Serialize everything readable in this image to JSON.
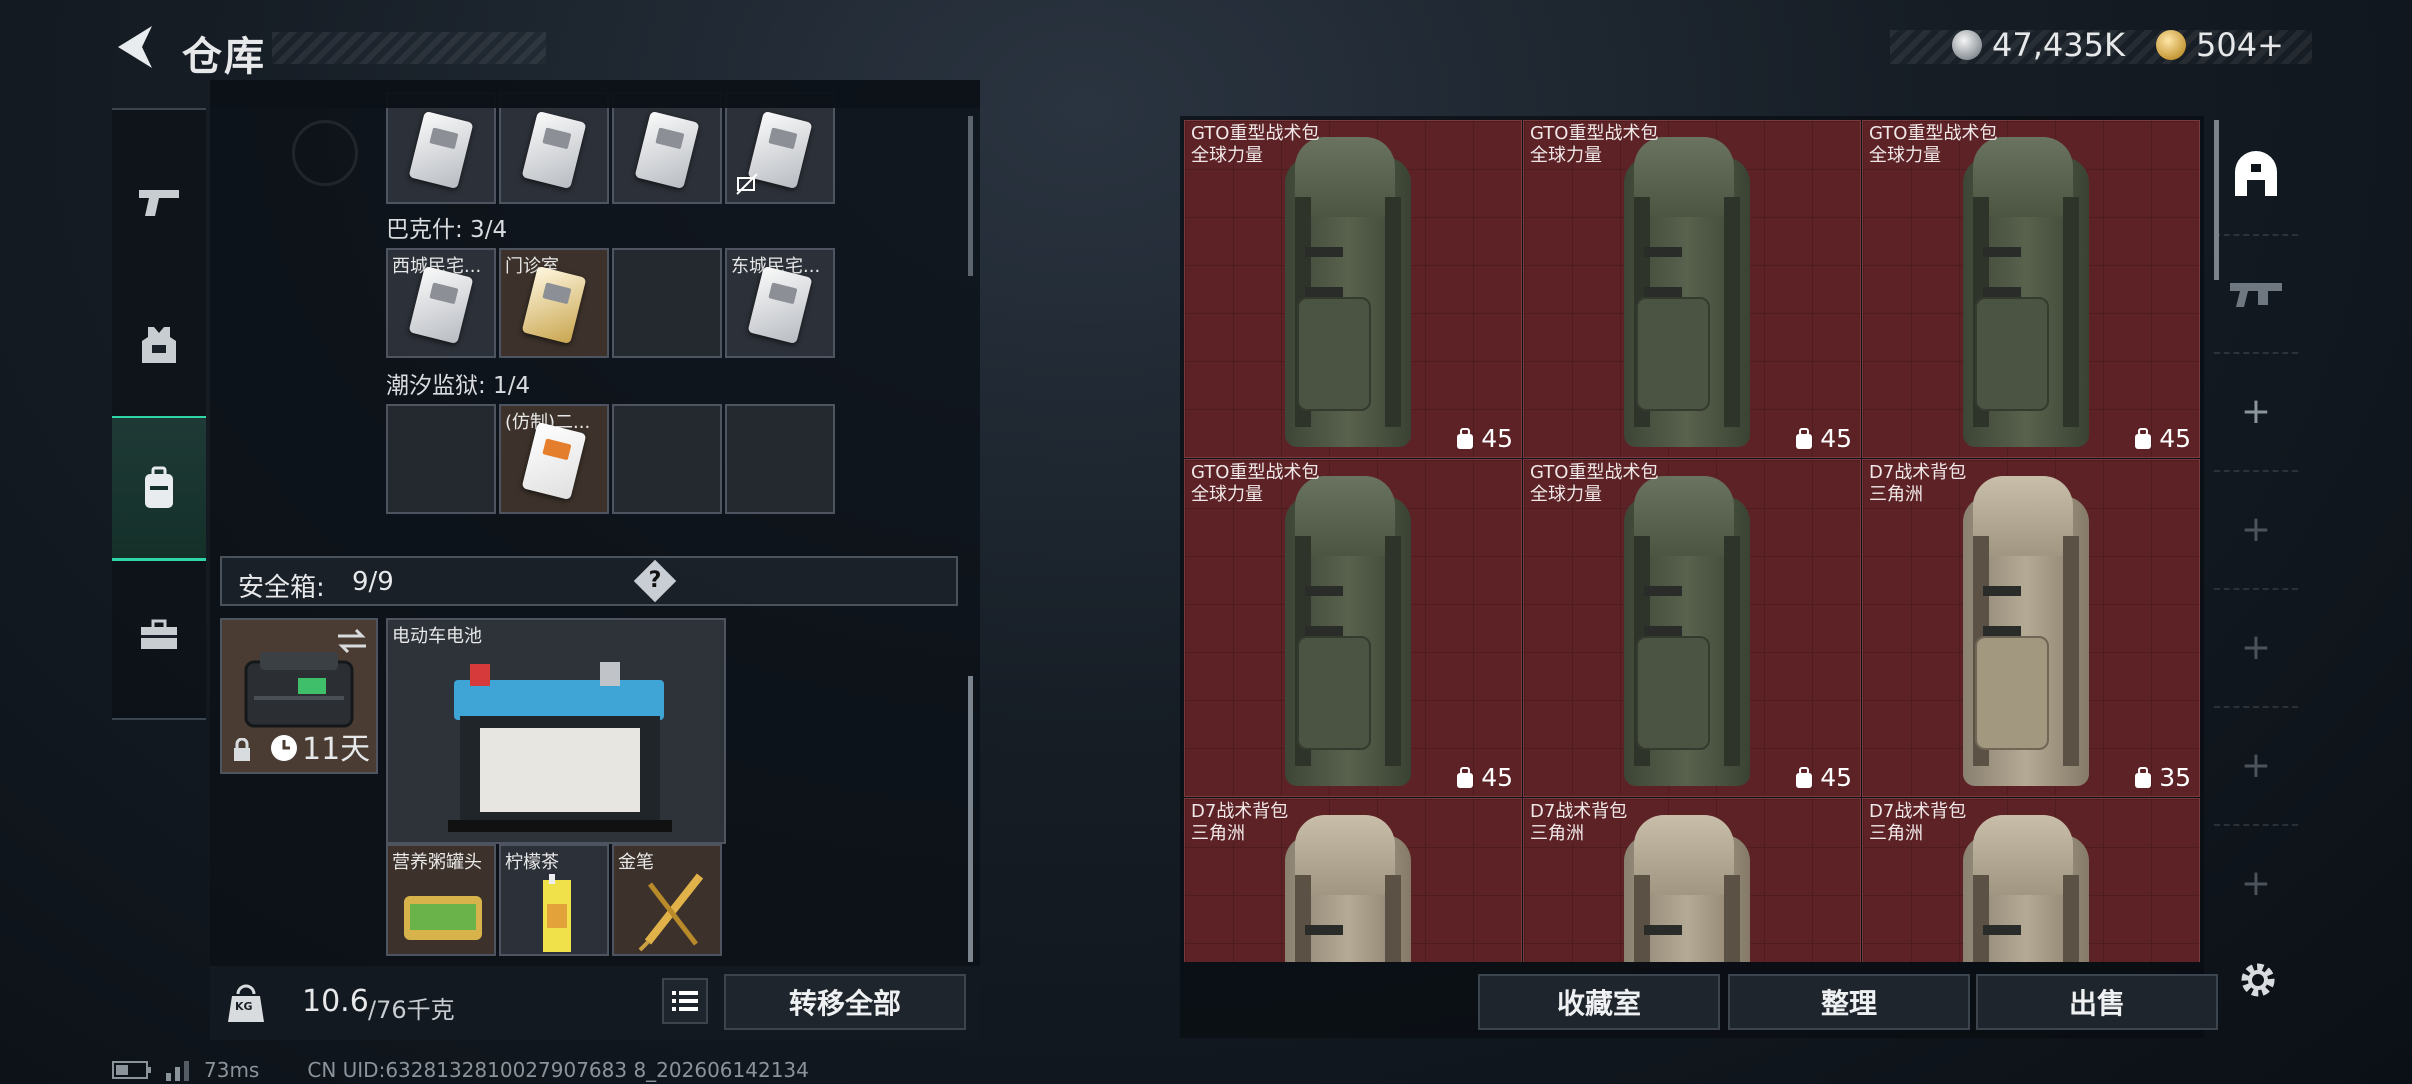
{
  "header": {
    "title": "仓库",
    "currency_primary": "47,435K",
    "currency_secondary": "504+"
  },
  "nav": {
    "items": [
      {
        "icon": "pistol-icon"
      },
      {
        "icon": "armor-vest-icon"
      },
      {
        "icon": "backpack-icon",
        "active": true
      },
      {
        "icon": "toolbox-icon"
      }
    ]
  },
  "storage": {
    "row1_cells": [
      {
        "label": "",
        "item": "keycard"
      },
      {
        "label": "",
        "item": "keycard"
      },
      {
        "label": "",
        "item": "keycard"
      },
      {
        "label": "",
        "item": "keycard",
        "flag": "crossed-icon"
      }
    ],
    "section_bakeshi": "巴克什: 3/4",
    "bakeshi_cells": [
      {
        "label": "西城民宅...",
        "item": "keycard"
      },
      {
        "label": "门诊室",
        "item": "keycard-gold"
      },
      {
        "label": "",
        "item": ""
      },
      {
        "label": "东城民宅...",
        "item": "keycard"
      }
    ],
    "section_chaoxi": "潮汐监狱: 1/4",
    "chaoxi_cells": [
      {
        "label": "",
        "item": ""
      },
      {
        "label": "(仿制)二...",
        "item": "keycard-orange"
      },
      {
        "label": "",
        "item": ""
      },
      {
        "label": "",
        "item": ""
      }
    ],
    "safe_box_label": "安全箱:",
    "safe_box_count": "9/9",
    "help_symbol": "?",
    "safe_case_days": "11天",
    "battery_label": "电动车电池",
    "small_items": [
      "营养粥罐头",
      "柠檬茶",
      "金笔"
    ],
    "weight_current": "10.6",
    "weight_max": "/76千克",
    "weight_badge": "KG",
    "transfer_all": "转移全部"
  },
  "backpacks": [
    {
      "name": "GTO重型战术包",
      "sub": "全球力量",
      "capacity": "45",
      "color": "green"
    },
    {
      "name": "GTO重型战术包",
      "sub": "全球力量",
      "capacity": "45",
      "color": "green"
    },
    {
      "name": "GTO重型战术包",
      "sub": "全球力量",
      "capacity": "45",
      "color": "green"
    },
    {
      "name": "GTO重型战术包",
      "sub": "全球力量",
      "capacity": "45",
      "color": "green"
    },
    {
      "name": "GTO重型战术包",
      "sub": "全球力量",
      "capacity": "45",
      "color": "green"
    },
    {
      "name": "D7战术背包",
      "sub": "三角洲",
      "capacity": "35",
      "color": "tan"
    },
    {
      "name": "D7战术背包",
      "sub": "三角洲",
      "capacity": "",
      "color": "tan"
    },
    {
      "name": "D7战术背包",
      "sub": "三角洲",
      "capacity": "",
      "color": "tan"
    },
    {
      "name": "D7战术背包",
      "sub": "三角洲",
      "capacity": "",
      "color": "tan"
    }
  ],
  "right_actions": {
    "collection": "收藏室",
    "organize": "整理",
    "sell": "出售"
  },
  "rail": {
    "add": "+"
  },
  "footer": {
    "ping": "73ms",
    "uid": "CN UID:6328132810027907683 8_202606142134"
  }
}
